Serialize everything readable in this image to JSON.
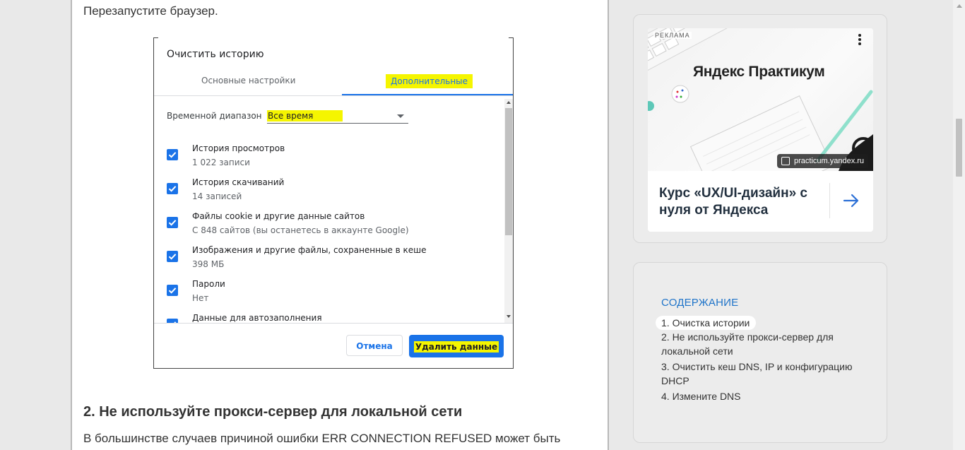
{
  "article": {
    "intro": "Перезапустите браузер.",
    "section_heading": "2. Не используйте прокси-сервер для локальной сети",
    "paragraph": "В большинстве случаев причиной ошибки ERR CONNECTION REFUSED может быть"
  },
  "dialog": {
    "title": "Очистить историю",
    "tabs": [
      {
        "label": "Основные настройки",
        "active": false
      },
      {
        "label": "Дополнительные",
        "active": true
      }
    ],
    "time_range_label": "Временной диапазон",
    "time_range_value": "Все время",
    "items": [
      {
        "title": "История просмотров",
        "subtitle": "1 022 записи",
        "checked": true
      },
      {
        "title": "История скачиваний",
        "subtitle": "14 записей",
        "checked": true
      },
      {
        "title": "Файлы cookie и другие данные сайтов",
        "subtitle": "С 848 сайтов (вы останетесь в аккаунте Google)",
        "checked": true
      },
      {
        "title": "Изображения и другие файлы, сохраненные в кеше",
        "subtitle": "398 МБ",
        "checked": true
      },
      {
        "title": "Пароли",
        "subtitle": "Нет",
        "checked": true
      },
      {
        "title": "Данные для автозаполнения",
        "subtitle": "",
        "checked": true
      }
    ],
    "cancel_label": "Отмена",
    "delete_label": "Удалить данные",
    "highlight_color": "#f5f500",
    "accent_color": "#1a73e8"
  },
  "ad": {
    "tag": "РЕКЛАМА",
    "brand": "Яндекс Практикум",
    "domain": "practicum.yandex.ru",
    "headline": "Курс «UX/UI-дизайн» с нуля от Яндекса"
  },
  "toc": {
    "title": "СОДЕРЖАНИЕ",
    "items": [
      "1. Очистка истории",
      "2. Не используйте прокси-сервер для локальной сети",
      "3. Очистить кеш DNS, IP и конфигурацию DHCP",
      "4. Измените DNS"
    ],
    "active_index": 0,
    "title_color": "#1f74c9"
  }
}
